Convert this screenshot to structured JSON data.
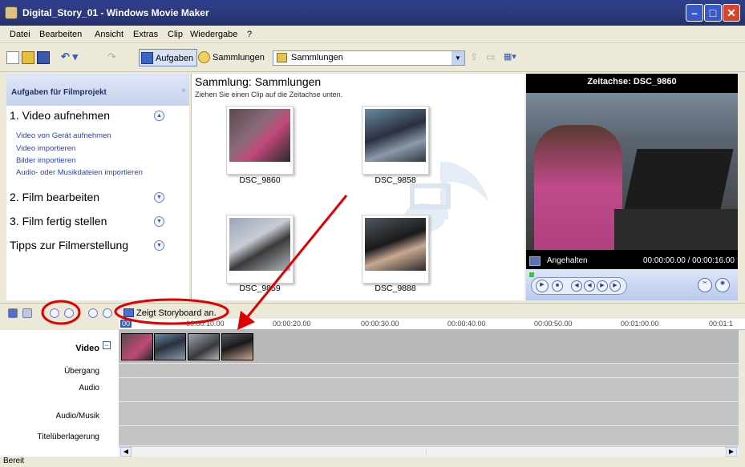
{
  "window": {
    "title": "Digital_Story_01 - Windows Movie Maker"
  },
  "menu": [
    "Datei",
    "Bearbeiten",
    "Ansicht",
    "Extras",
    "Clip",
    "Wiedergabe",
    "?"
  ],
  "toolbar": {
    "tasks_label": "Aufgaben",
    "collections_label": "Sammlungen",
    "collection_combo_value": "Sammlungen"
  },
  "tasks": {
    "header": "Aufgaben für Filmprojekt",
    "sections": [
      {
        "title": "1. Video aufnehmen",
        "expanded": true,
        "links": [
          "Video von Gerät aufnehmen",
          "Video importieren",
          "Bilder importieren",
          "Audio- oder Musikdateien importieren"
        ]
      },
      {
        "title": "2. Film bearbeiten",
        "expanded": false
      },
      {
        "title": "3. Film fertig stellen",
        "expanded": false
      },
      {
        "title": "Tipps zur Filmerstellung",
        "expanded": false
      }
    ]
  },
  "collection": {
    "title": "Sammlung: Sammlungen",
    "subtitle": "Ziehen Sie einen Clip auf die Zeitachse unten.",
    "clips": [
      "DSC_9860",
      "DSC_9858",
      "DSC_9859",
      "DSC_9888"
    ]
  },
  "monitor": {
    "title": "Zeitachse: DSC_9860",
    "status": "Angehalten",
    "time": "00:00:00.00 / 00:00:16.00"
  },
  "timeline": {
    "storyboard_button": "Zeigt Storyboard an.",
    "ruler": [
      "00:00:10.00",
      "00:00:20.00",
      "00:00:30.00",
      "00:00:40.00",
      "00:00:50.00",
      "00:01:00.00",
      "00:01:1"
    ],
    "tracks": [
      "Video",
      "Übergang",
      "Audio",
      "Audio/Musik",
      "Titelüberlagerung"
    ],
    "clip_count": 4
  },
  "statusbar": {
    "text": "Bereit"
  },
  "colors": {
    "annotation": "#e00000",
    "titlebar": "#2b3a7d",
    "link": "#2640c8"
  }
}
